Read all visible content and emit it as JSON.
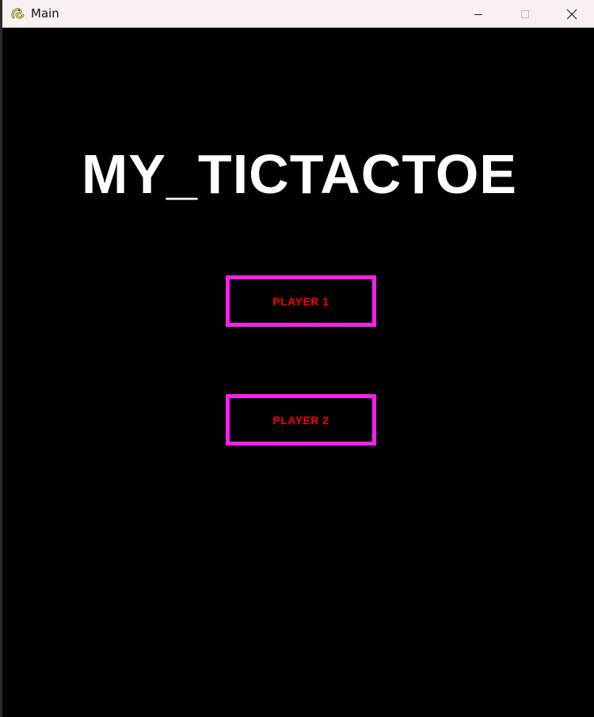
{
  "window": {
    "title": "Main",
    "app_icon": "pygame-snake-icon",
    "controls": {
      "minimize_icon": "minimize-icon",
      "maximize_icon": "maximize-icon",
      "close_icon": "close-icon"
    }
  },
  "game": {
    "title": "MY_TICTACTOE",
    "buttons": [
      {
        "label": "PLAYER 1"
      },
      {
        "label": "PLAYER 2"
      }
    ]
  },
  "colors": {
    "background": "#000000",
    "title_text": "#ffffff",
    "button_border": "#ff1ef0",
    "button_text": "#ff0000",
    "titlebar": "#f8f1f0"
  }
}
